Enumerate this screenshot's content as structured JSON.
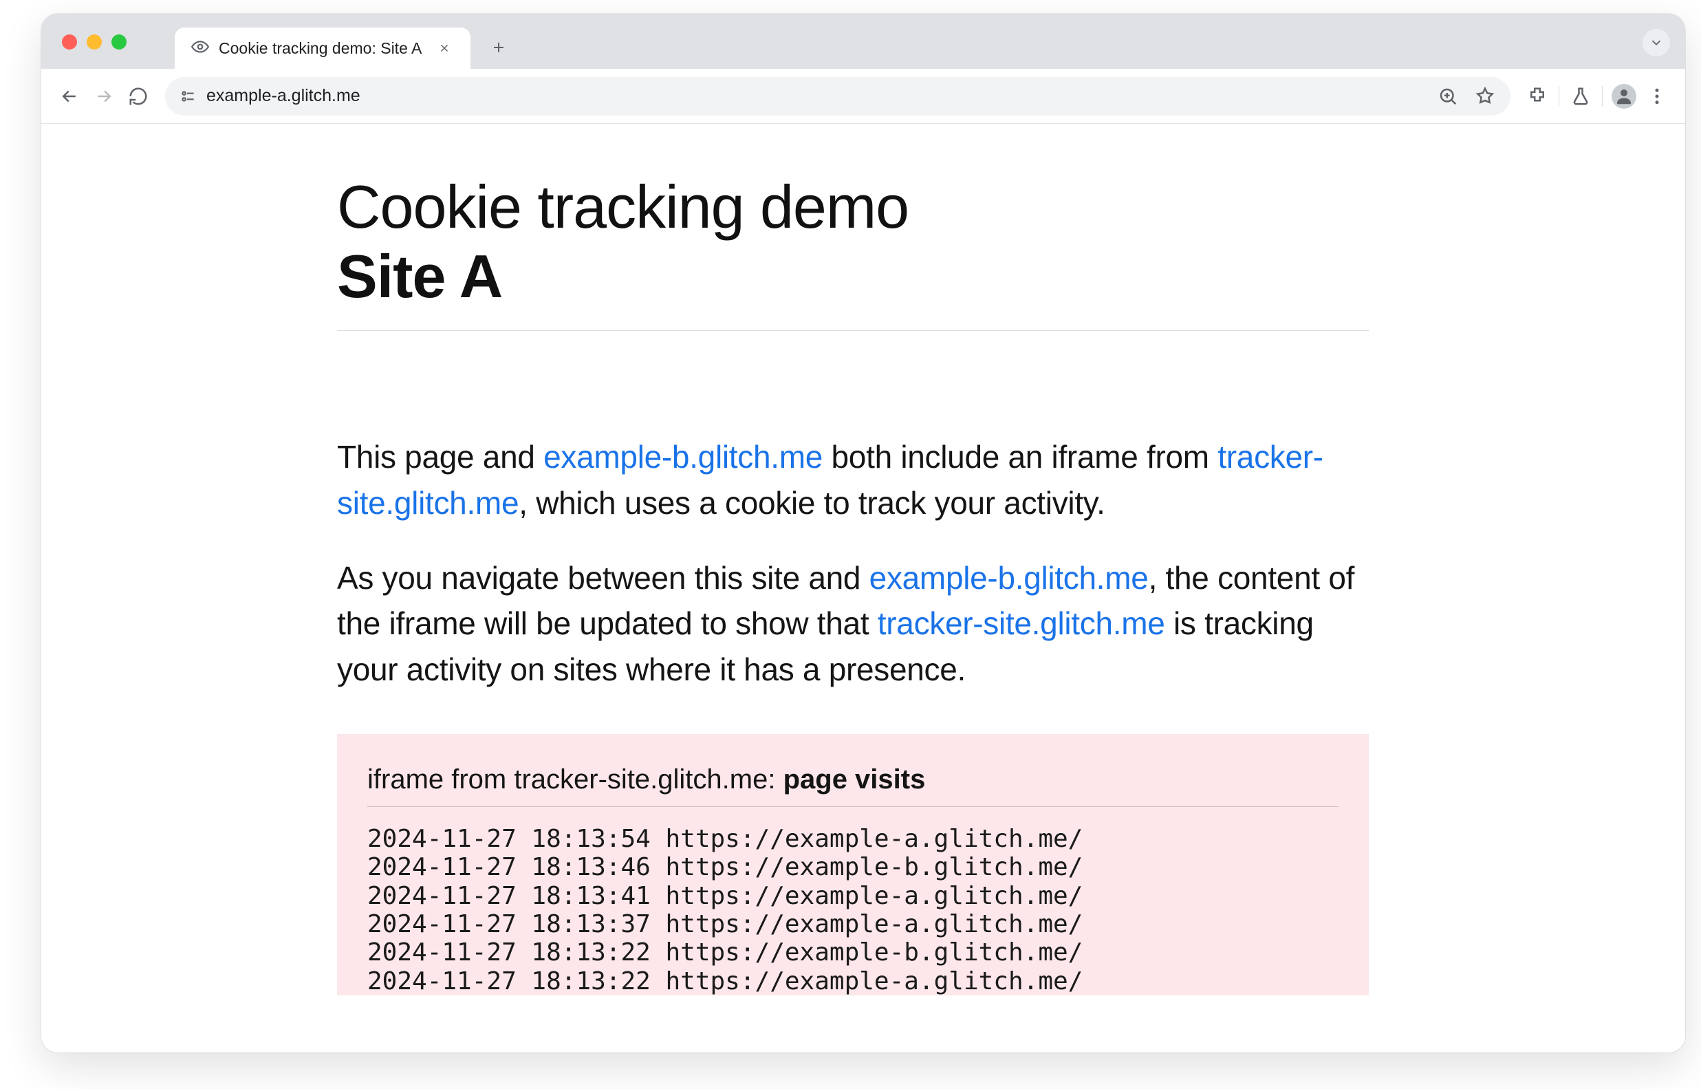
{
  "browser": {
    "tab_title": "Cookie tracking demo: Site A",
    "url": "example-a.glitch.me"
  },
  "page": {
    "title_line1": "Cookie tracking demo",
    "title_line2": "Site A",
    "para1": {
      "t0": "This page and ",
      "link1": "example-b.glitch.me",
      "t1": " both include an iframe from ",
      "link2": "tracker-site.glitch.me",
      "t2": ", which uses a cookie to track your activity."
    },
    "para2": {
      "t0": "As you navigate between this site and ",
      "link1": "example-b.glitch.me",
      "t1": ", the content of the iframe will be updated to show that ",
      "link2": "tracker-site.glitch.me",
      "t2": " is tracking your activity on sites where it has a presence."
    },
    "iframe": {
      "heading_prefix": "iframe from tracker-site.glitch.me: ",
      "heading_bold": "page visits",
      "log_entries": [
        "2024-11-27 18:13:54 https://example-a.glitch.me/",
        "2024-11-27 18:13:46 https://example-b.glitch.me/",
        "2024-11-27 18:13:41 https://example-a.glitch.me/",
        "2024-11-27 18:13:37 https://example-a.glitch.me/",
        "2024-11-27 18:13:22 https://example-b.glitch.me/",
        "2024-11-27 18:13:22 https://example-a.glitch.me/"
      ]
    }
  }
}
